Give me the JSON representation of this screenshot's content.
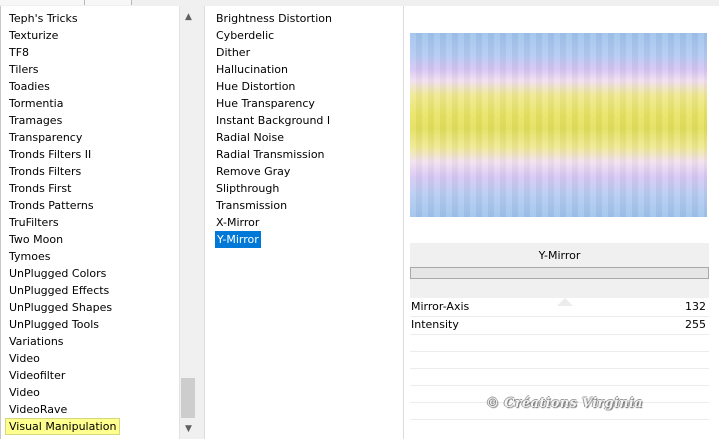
{
  "categories": [
    "Teph's Tricks",
    "Texturize",
    "TF8",
    "Tilers",
    "Toadies",
    "Tormentia",
    "Tramages",
    "Transparency",
    "Tronds Filters II",
    "Tronds Filters",
    "Tronds First",
    "Tronds Patterns",
    "TruFilters",
    "Two Moon",
    "Tymoes",
    "UnPlugged Colors",
    "UnPlugged Effects",
    "UnPlugged Shapes",
    "UnPlugged Tools",
    "Variations",
    "Video",
    "Videofilter",
    "Video",
    "VideoRave",
    "Visual Manipulation"
  ],
  "selected_category_index": 24,
  "effects": [
    "Brightness Distortion",
    "Cyberdelic",
    "Dither",
    "Hallucination",
    "Hue Distortion",
    "Hue Transparency",
    "Instant Background I",
    "Radial Noise",
    "Radial Transmission",
    "Remove Gray",
    "Slipthrough",
    "Transmission",
    "X-Mirror",
    "Y-Mirror"
  ],
  "selected_effect_index": 13,
  "filter_name": "Y-Mirror",
  "params": [
    {
      "name": "Mirror-Axis",
      "value": "132"
    },
    {
      "name": "Intensity",
      "value": "255"
    }
  ],
  "watermark": "© Créations Virginia",
  "scrollbar": {
    "up_icon": "chevron-up-icon",
    "down_icon": "chevron-down-icon"
  },
  "colors": {
    "selection_blue": "#0078d7",
    "selection_yellow": "#ffff8f"
  }
}
